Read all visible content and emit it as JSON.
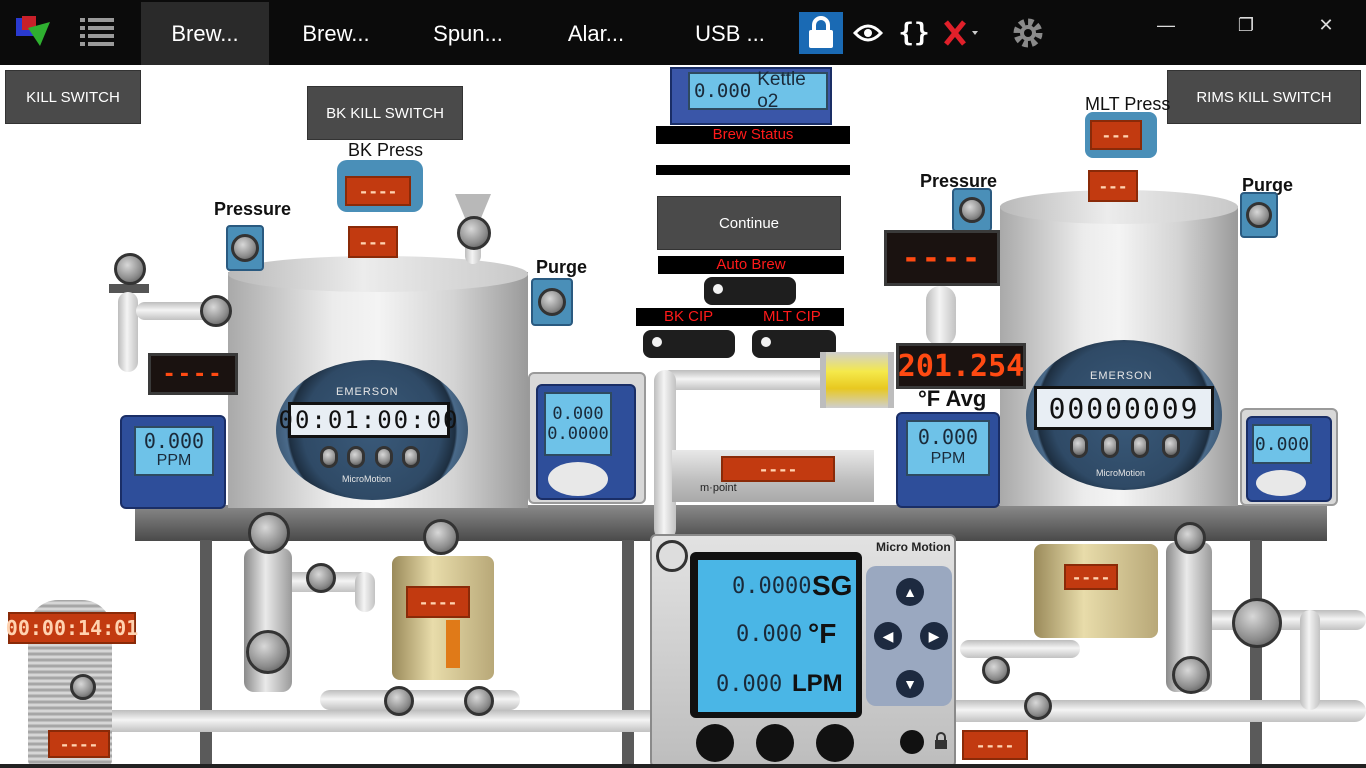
{
  "topbar": {
    "tabs": [
      {
        "label": "Brew...",
        "active": true
      },
      {
        "label": "Brew...",
        "active": false
      },
      {
        "label": "Spun...",
        "active": false
      },
      {
        "label": "Alar...",
        "active": false
      },
      {
        "label": "USB ...",
        "active": false
      }
    ],
    "icons": [
      "app-logo-icon",
      "list-menu-icon",
      "lock-icon",
      "eye-icon",
      "code-braces-icon",
      "red-x-icon",
      "gear-icon"
    ],
    "window": {
      "minimize": "—",
      "restore": "❐",
      "close": "✕"
    },
    "colors": {
      "bar": "#0b0b0b",
      "active_tab": "#2a2a2a",
      "lock_bg": "#1a6ab4",
      "x_color": "#e0202a"
    }
  },
  "buttons": {
    "kill_switch": "KILL SWITCH",
    "bk_kill_switch": "BK KILL SWITCH",
    "rims_kill_switch": "RIMS KILL SWITCH",
    "continue": "Continue"
  },
  "labels": {
    "bk_press": "BK Press",
    "pressure_left": "Pressure",
    "purge_left": "Purge",
    "pressure_right": "Pressure",
    "purge_right": "Purge",
    "mlt_press": "MLT Press",
    "f_avg": "°F Avg",
    "ppm_left": "PPM",
    "ppm_right": "PPM",
    "sg": "SG",
    "f_unit": "°F",
    "lpm": "LPM",
    "mpoint": "m·point",
    "emerson": "EMERSON",
    "micromotion": "MicroMotion",
    "micromotion_header": "Micro Motion"
  },
  "status": {
    "brew_status": "Brew Status",
    "auto_brew": "Auto Brew",
    "bk_cip": "BK CIP",
    "mlt_cip": "MLT CIP",
    "kettle_o2": "Kettle o2",
    "kettle_o2_value": "0.000"
  },
  "readouts": {
    "dash4": "----",
    "dash3": "---",
    "bk_pressure_led": "----",
    "mlt_pressure_led": "----",
    "temp_avg": "201.254",
    "timer": "00:00:14:01",
    "bk_flow_total": "00:01:00:00",
    "mlt_flow_total": "00000009",
    "ppm_left_value": "0.000",
    "ppm_right_value": "0.000",
    "bk_transmitter_top": "0.000",
    "bk_transmitter_bottom": "0.0000",
    "mlt_transmitter": "0.000",
    "sg_value": "0.0000",
    "temp_value": "0.000",
    "lpm_value": "0.000"
  }
}
